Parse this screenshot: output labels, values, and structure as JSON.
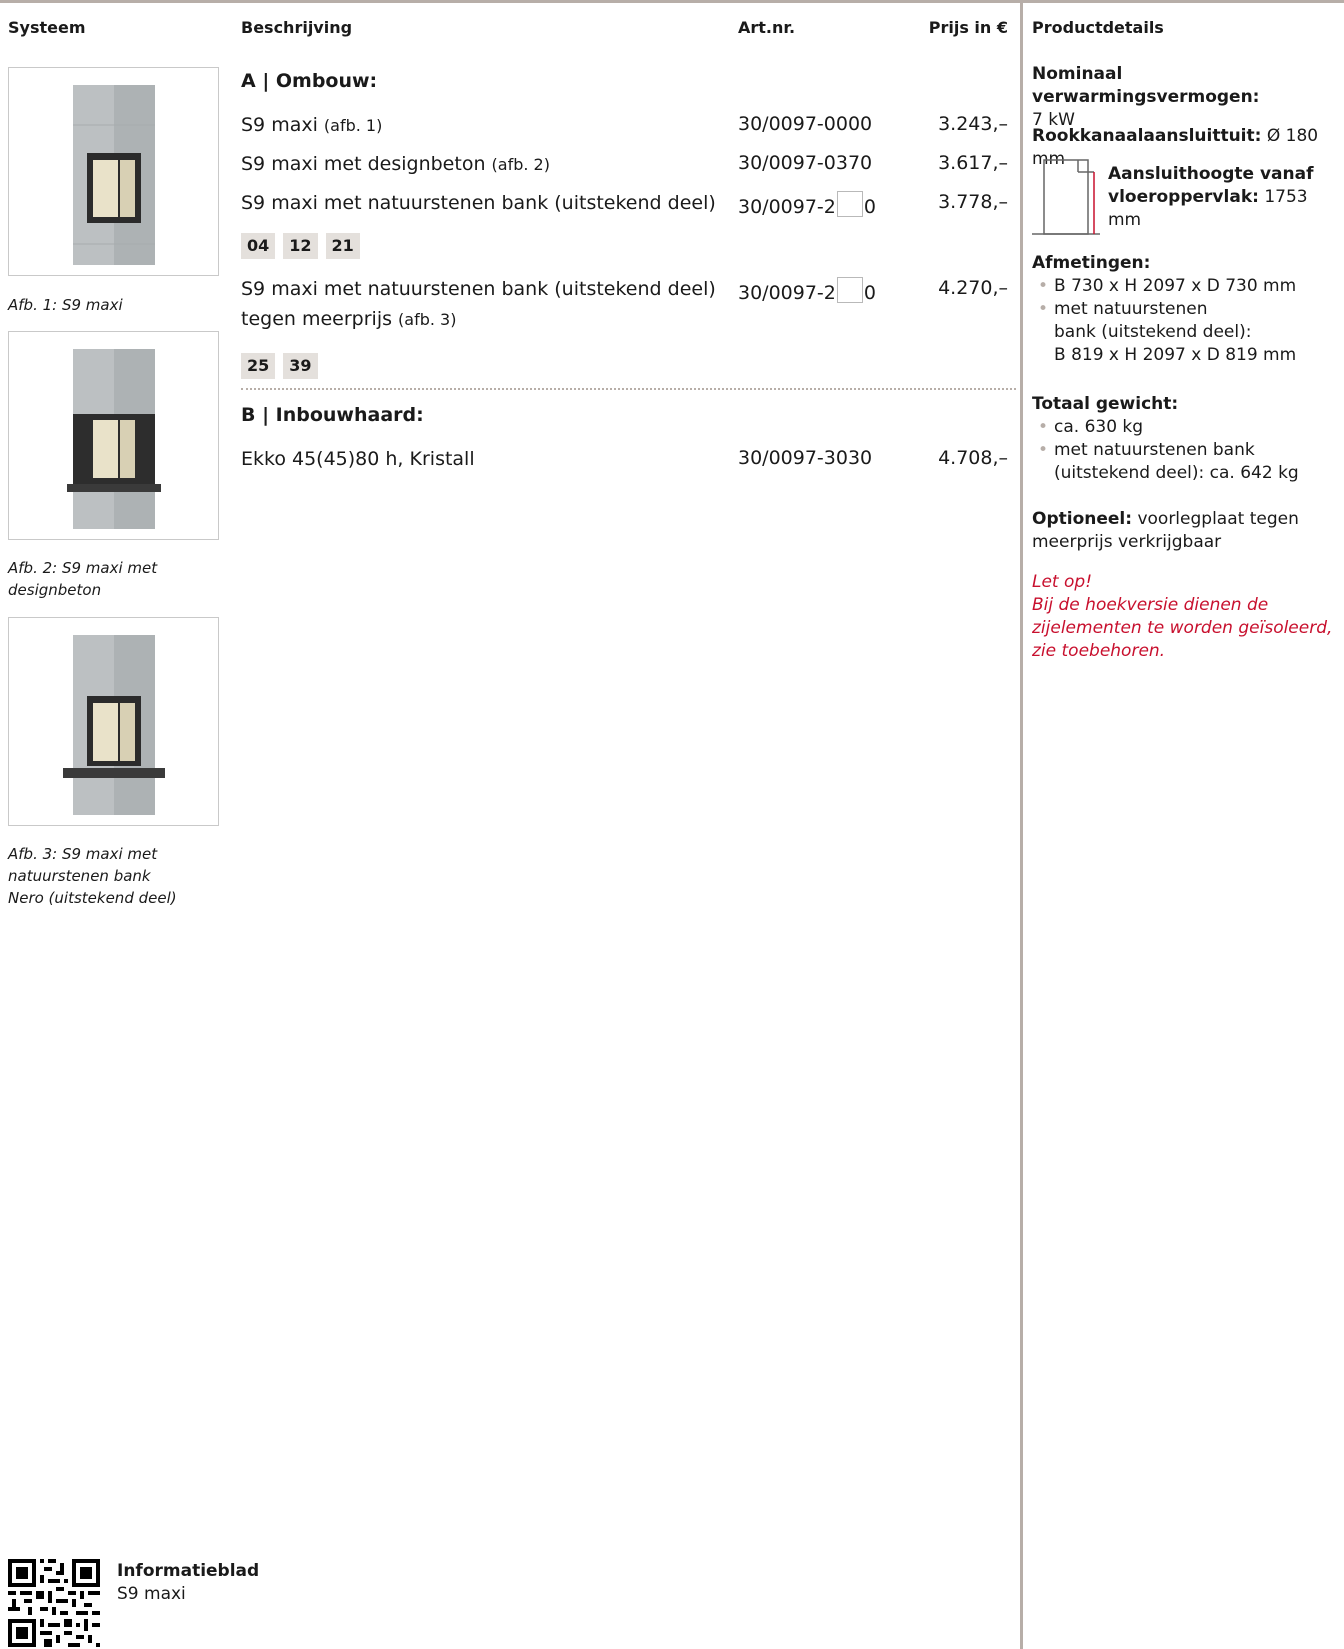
{
  "header": {
    "systeem": "Systeem",
    "beschrijving": "Beschrijving",
    "artnr": "Art.nr.",
    "prijs": "Prijs in €",
    "productdetails": "Productdetails"
  },
  "figures": [
    {
      "caption_lines": [
        "Afb. 1: S9 maxi"
      ]
    },
    {
      "caption_lines": [
        "Afb. 2: S9 maxi met",
        "designbeton"
      ]
    },
    {
      "caption_lines": [
        "Afb. 3: S9 maxi met",
        "natuurstenen bank",
        "Nero (uitstekend deel)"
      ]
    }
  ],
  "sections": {
    "a_title": "A | Ombouw:",
    "b_title": "B | Inbouwhaard:"
  },
  "rows": [
    {
      "desc": "S9 maxi",
      "note": "(afb. 1)",
      "art": "30/0097-0000",
      "price": "3.243,–"
    },
    {
      "desc": "S9 maxi met designbeton",
      "note": "(afb. 2)",
      "art": "30/0097-0370",
      "price": "3.617,–"
    },
    {
      "desc": "S9 maxi met natuurstenen bank (uitstekend deel)",
      "note": "",
      "art_pre": "30/0097-2",
      "art_post": "0",
      "price": "3.778,–"
    },
    {
      "desc": "S9 maxi met natuurstenen bank (uitstekend deel)",
      "desc2": "tegen meerprijs",
      "note": "(afb. 3)",
      "art_pre": "30/0097-2",
      "art_post": "0",
      "price": "4.270,–"
    },
    {
      "desc": "Ekko 45(45)80 h, Kristall",
      "note": "",
      "art": "30/0097-3030",
      "price": "4.708,–"
    }
  ],
  "chips_a": [
    "04",
    "12",
    "21"
  ],
  "chips_b": [
    "25",
    "39"
  ],
  "details": {
    "vermogen_label": "Nominaal verwarmingsvermogen:",
    "vermogen_value": "7 kW",
    "rook_label": "Rookkanaalaansluittuit:",
    "rook_value": "Ø 180 mm",
    "hoogte_label1": "Aansluithoogte vanaf",
    "hoogte_label2": "vloeroppervlak:",
    "hoogte_value": "1753 mm",
    "afm_label": "Afmetingen:",
    "afm_1": "B 730 x H 2097 x D 730 mm",
    "afm_2a": "met natuurstenen",
    "afm_2b": "bank (uitstekend deel):",
    "afm_2c": "B 819 x H 2097 x D 819 mm",
    "gew_label": "Totaal gewicht:",
    "gew_1": "ca. 630 kg",
    "gew_2a": "met natuurstenen bank",
    "gew_2b": "(uitstekend deel): ca. 642 kg",
    "opt_label": "Optioneel:",
    "opt_text1": "voorlegplaat tegen",
    "opt_text2": "meerprijs verkrijgbaar",
    "warn_1": "Let op!",
    "warn_2": "Bij de hoekversie dienen de",
    "warn_3": "zijelementen te worden geïsoleerd,",
    "warn_4": "zie toebehoren."
  },
  "footer": {
    "title": "Informatieblad",
    "subtitle": "S9 maxi"
  },
  "colors": {
    "rule": "#b7aea8",
    "chip_bg": "#e4e0dc",
    "warning": "#c8102e"
  }
}
